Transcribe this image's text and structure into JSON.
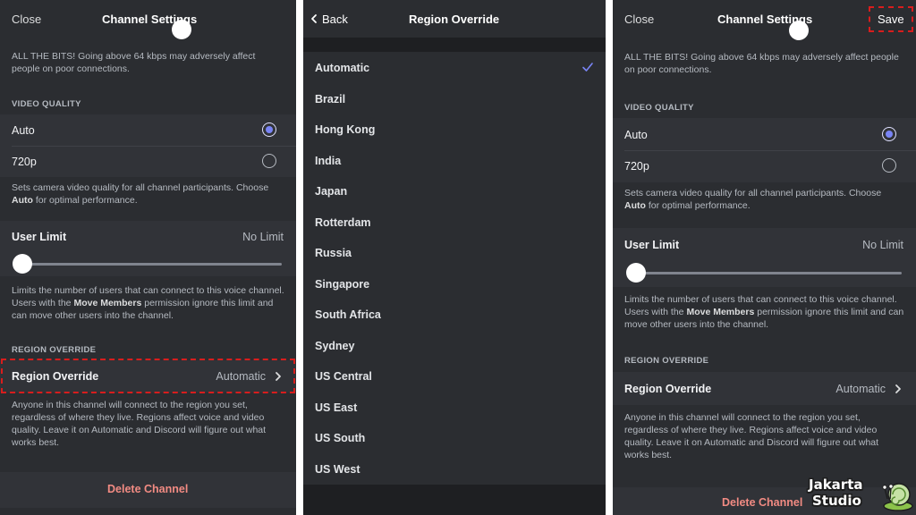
{
  "colors": {
    "panel_bg": "#2b2d31",
    "row_bg": "#313338",
    "accent": "#7984f5",
    "danger": "#f28b83",
    "highlight": "#d81d1d"
  },
  "screen1": {
    "header": {
      "close_label": "Close",
      "title": "Channel Settings"
    },
    "bitrate_desc": "ALL THE BITS! Going above 64 kbps may adversely affect people on poor connections.",
    "video_quality": {
      "section_title": "VIDEO QUALITY",
      "options": [
        {
          "label": "Auto",
          "selected": true
        },
        {
          "label": "720p",
          "selected": false
        }
      ],
      "desc_a": "Sets camera video quality for all channel participants. Choose ",
      "desc_bold": "Auto",
      "desc_b": " for optimal performance."
    },
    "user_limit": {
      "label": "User Limit",
      "value": "No Limit",
      "slider_fraction": 0,
      "desc_a": "Limits the number of users that can connect to this voice channel. Users with the ",
      "desc_bold": "Move Members",
      "desc_b": " permission ignore this limit and can move other users into the channel."
    },
    "region_override": {
      "section_title": "REGION OVERRIDE",
      "label": "Region Override",
      "value": "Automatic",
      "desc": "Anyone in this channel will connect to the region you set, regardless of where they live. Regions affect voice and video quality. Leave it on Automatic and Discord will figure out what works best."
    },
    "delete_label": "Delete Channel"
  },
  "screen2": {
    "header": {
      "back_label": "Back",
      "title": "Region Override"
    },
    "regions": [
      {
        "label": "Automatic",
        "selected": true
      },
      {
        "label": "Brazil",
        "selected": false
      },
      {
        "label": "Hong Kong",
        "selected": false
      },
      {
        "label": "India",
        "selected": false
      },
      {
        "label": "Japan",
        "selected": false
      },
      {
        "label": "Rotterdam",
        "selected": false
      },
      {
        "label": "Russia",
        "selected": false
      },
      {
        "label": "Singapore",
        "selected": false
      },
      {
        "label": "South Africa",
        "selected": false
      },
      {
        "label": "Sydney",
        "selected": false
      },
      {
        "label": "US Central",
        "selected": false
      },
      {
        "label": "US East",
        "selected": false
      },
      {
        "label": "US South",
        "selected": false
      },
      {
        "label": "US West",
        "selected": false
      }
    ]
  },
  "screen3": {
    "header": {
      "close_label": "Close",
      "title": "Channel Settings",
      "save_label": "Save"
    },
    "bitrate_desc": "ALL THE BITS! Going above 64 kbps may adversely affect people on poor connections.",
    "video_quality": {
      "section_title": "VIDEO QUALITY",
      "options": [
        {
          "label": "Auto",
          "selected": true
        },
        {
          "label": "720p",
          "selected": false
        }
      ],
      "desc_a": "Sets camera video quality for all channel participants. Choose ",
      "desc_bold": "Auto",
      "desc_b": " for optimal performance."
    },
    "user_limit": {
      "label": "User Limit",
      "value": "No Limit",
      "slider_fraction": 0,
      "desc_a": "Limits the number of users that can connect to this voice channel. Users with the ",
      "desc_bold": "Move Members",
      "desc_b": " permission ignore this limit and can move other users into the channel."
    },
    "region_override": {
      "section_title": "REGION OVERRIDE",
      "label": "Region Override",
      "value": "Automatic",
      "desc": "Anyone in this channel will connect to the region you set, regardless of where they live. Regions affect voice and video quality. Leave it on Automatic and Discord will figure out what works best."
    },
    "delete_label": "Delete Channel"
  },
  "watermark": {
    "line1": "Jakarta",
    "line2": "Studio"
  }
}
